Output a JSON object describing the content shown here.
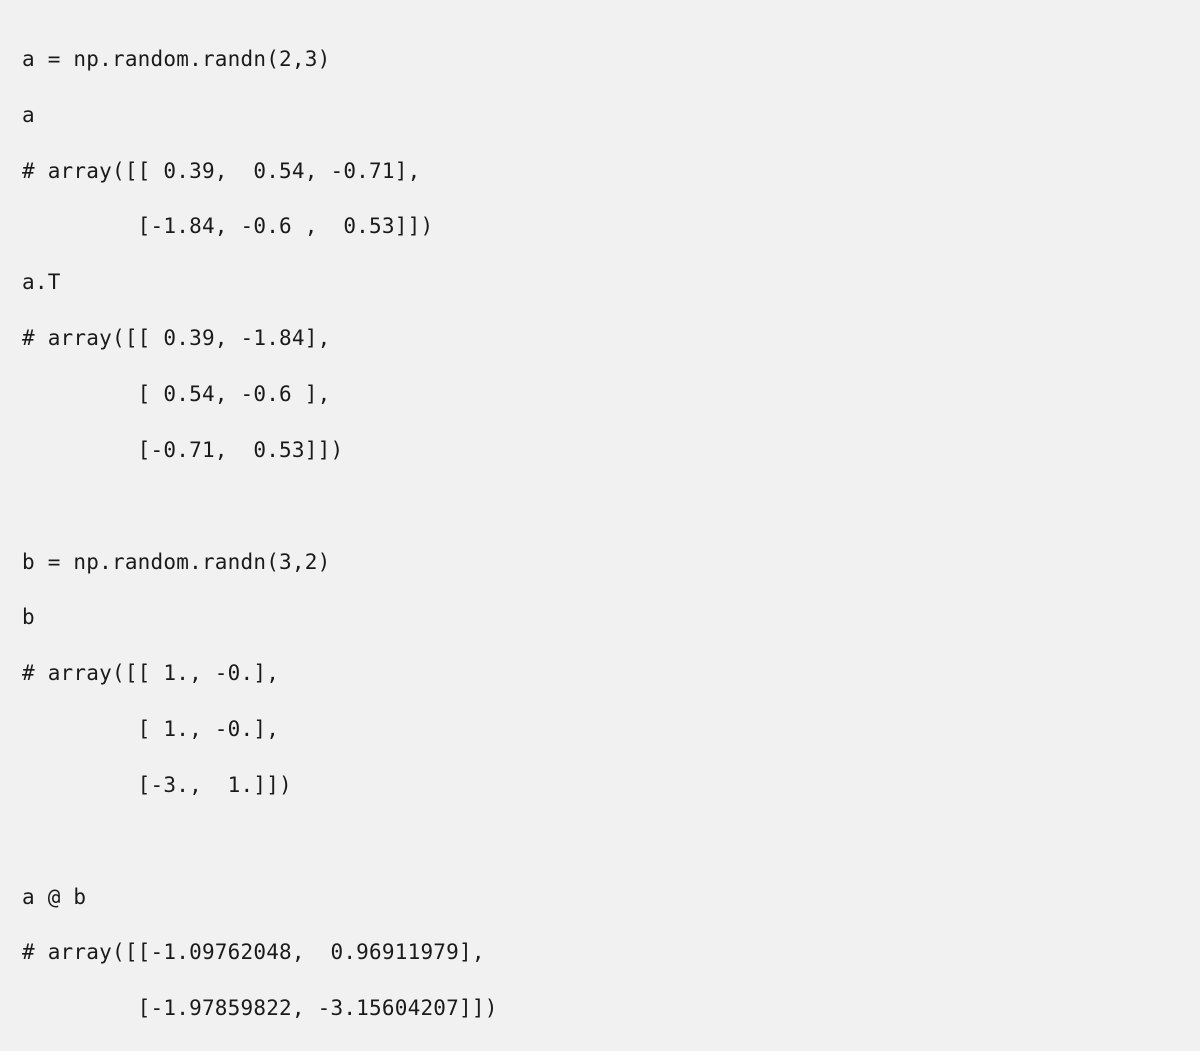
{
  "code": {
    "l01": "a = np.random.randn(2,3)",
    "l02": "a",
    "l03": "# array([[ 0.39,  0.54, -0.71],",
    "l04": "         [-1.84, -0.6 ,  0.53]])",
    "l05": "a.T",
    "l06": "# array([[ 0.39, -1.84],",
    "l07": "         [ 0.54, -0.6 ],",
    "l08": "         [-0.71,  0.53]])",
    "l09": "",
    "l10": "",
    "l11": "b = np.random.randn(3,2)",
    "l12": "b",
    "l13": "# array([[ 1., -0.],",
    "l14": "         [ 1., -0.],",
    "l15": "         [-3.,  1.]])",
    "l16": "",
    "l17": "",
    "l18": "a @ b",
    "l19": "# array([[-1.09762048,  0.96911979],",
    "l20": "         [-1.97859822, -3.15604207]])"
  }
}
